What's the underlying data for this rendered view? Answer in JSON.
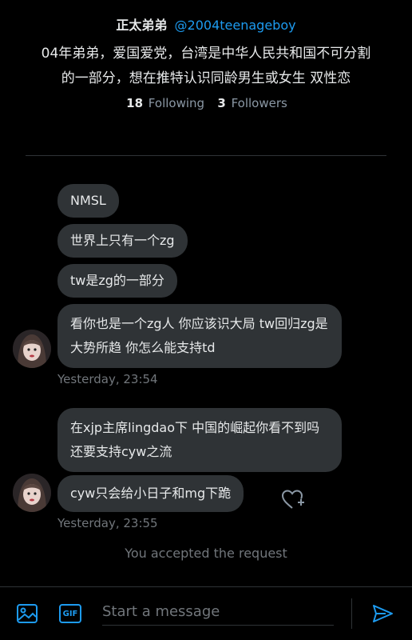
{
  "profile": {
    "display_name": "正太弟弟",
    "handle": "@2004teenageboy",
    "bio_line1": "04年弟弟，爱国爱党，台湾是中华人民共和国不可分割",
    "bio_line2": "的一部分，想在推特认识同龄男生或女生 双性恋",
    "following_count": "18",
    "following_label": "Following",
    "followers_count": "3",
    "followers_label": "Followers"
  },
  "messages": {
    "group1": [
      "NMSL",
      "世界上只有一个zg",
      "tw是zg的一部分",
      "看你也是一个zg人 你应该识大局 tw回归zg是大势所趋 你怎么能支持td"
    ],
    "group1_time": "Yesterday, 23:54",
    "group2": [
      "在xjp主席lingdao下 中国的崛起你看不到吗 还要支持cyw之流",
      "cyw只会给小日子和mg下跪"
    ],
    "group2_time": "Yesterday, 23:55"
  },
  "status": {
    "accepted": "You accepted the request"
  },
  "composer": {
    "placeholder": "Start a message",
    "gif_label": "GIF"
  },
  "colors": {
    "accent": "#1d9bf0",
    "bubble": "#2f3336",
    "background": "#000000"
  }
}
